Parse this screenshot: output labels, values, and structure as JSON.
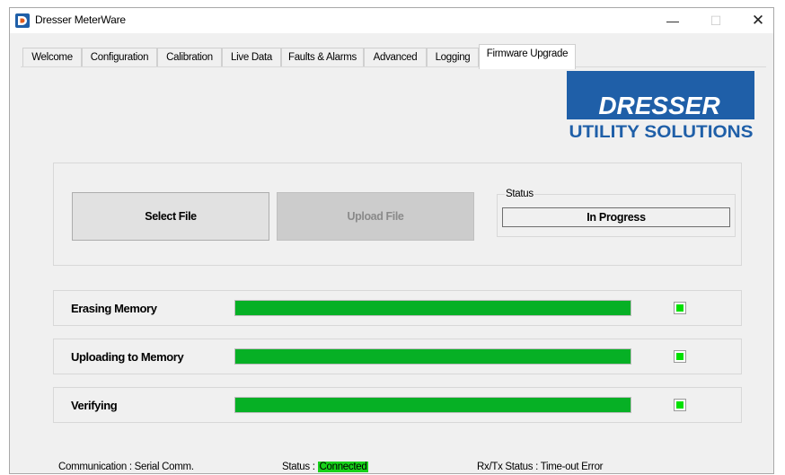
{
  "window": {
    "title": "Dresser MeterWare",
    "controls": {
      "minimize": "—",
      "maximize": "☐",
      "close": "✕"
    },
    "icon": "app-logo-icon"
  },
  "tabs": [
    {
      "label": "Welcome"
    },
    {
      "label": "Configuration"
    },
    {
      "label": "Calibration"
    },
    {
      "label": "Live Data"
    },
    {
      "label": "Faults & Alarms"
    },
    {
      "label": "Advanced"
    },
    {
      "label": "Logging"
    },
    {
      "label": "Firmware Upgrade",
      "active": true
    }
  ],
  "logo": {
    "line1": "DRESSER",
    "line2": "UTILITY SOLUTIONS",
    "colors": {
      "background": "#1f5fa8",
      "text": "#ffffff",
      "subtext": "#1f5fa8"
    }
  },
  "firmware": {
    "select_file_label": "Select File",
    "upload_file_label": "Upload File",
    "status_legend": "Status",
    "status_value": "In Progress"
  },
  "steps": [
    {
      "label": "Erasing Memory",
      "progress": 1.0,
      "done": true
    },
    {
      "label": "Uploading to Memory",
      "progress": 1.0,
      "done": true
    },
    {
      "label": "Verifying",
      "progress": 1.0,
      "done": true
    }
  ],
  "colors": {
    "progress": "#06b025",
    "indicator": "#00e000",
    "connected": "#17d11a"
  },
  "statusbar": {
    "communication": "Communication : Serial Comm.",
    "status_prefix": "Status : ",
    "status_value": "Connected",
    "rxtx": "Rx/Tx Status : Time-out Error"
  }
}
